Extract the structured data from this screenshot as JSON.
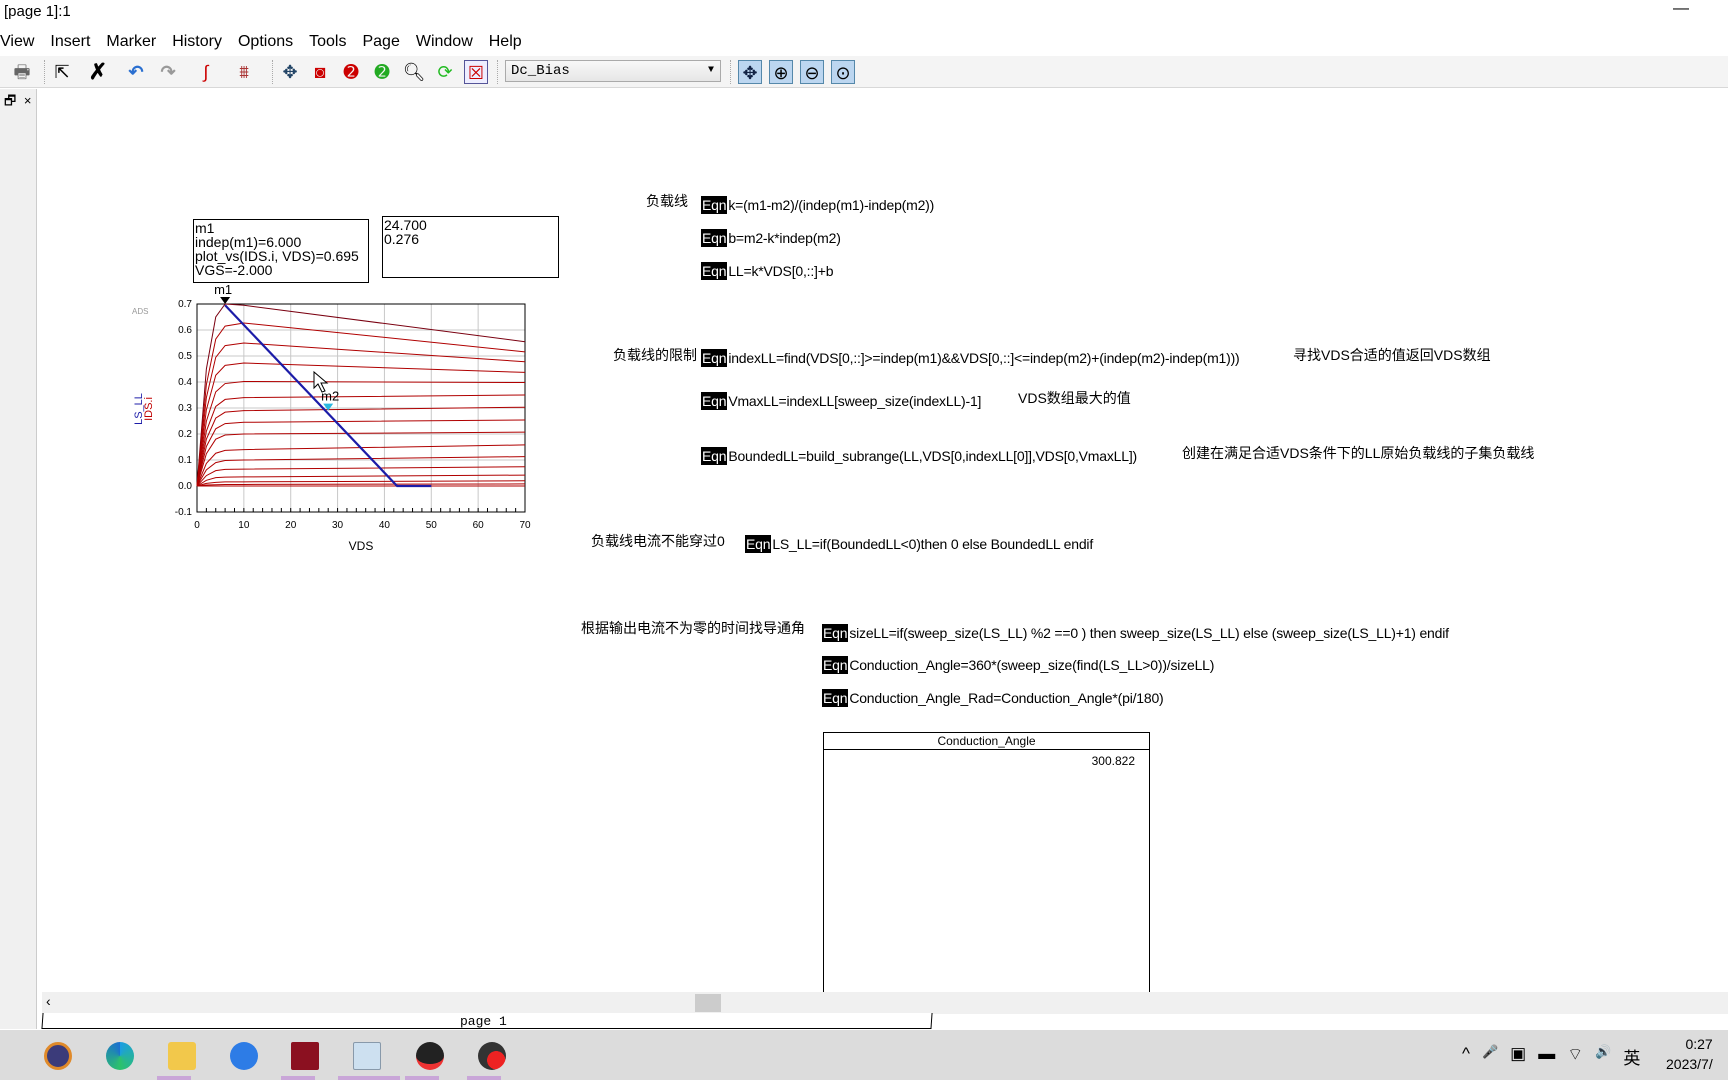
{
  "window": {
    "title": "[page 1]:1",
    "minimize": "—"
  },
  "menu": [
    "View",
    "Insert",
    "Marker",
    "History",
    "Options",
    "Tools",
    "Page",
    "Window",
    "Help"
  ],
  "toolbar": {
    "icons": [
      "save-icon",
      "print-icon",
      "select-arrow-icon",
      "delete-x-icon",
      "undo-icon",
      "redo-icon",
      "trace-icon",
      "plot-icon",
      "pan-icon",
      "zoom-box-icon",
      "zoom-in-2-icon",
      "zoom-out-2-icon",
      "zoom-icon",
      "refresh-icon",
      "clear-icon"
    ],
    "dataset": "Dc_Bias",
    "right_icons": [
      "fit-icon",
      "zoom-in-icon",
      "zoom-out-icon",
      "zoom-all-icon"
    ]
  },
  "pane": {
    "restore": "🗗",
    "close": "×"
  },
  "markers": {
    "m1_box": [
      "m1",
      "indep(m1)=6.000",
      "plot_vs(IDS.i, VDS)=0.695",
      "VGS=-2.000"
    ],
    "m2_box": [
      "24.700",
      "0.276"
    ]
  },
  "equations": [
    {
      "label": "负载线",
      "badge": "Eqn",
      "text": "k=(m1-m2)/(indep(m1)-indep(m2))"
    },
    {
      "badge": "Eqn",
      "text": "b=m2-k*indep(m2)"
    },
    {
      "badge": "Eqn",
      "text": "LL=k*VDS[0,::]+b"
    },
    {
      "label": "负载线的限制",
      "badge": "Eqn",
      "text": "indexLL=find(VDS[0,::]>=indep(m1)&&VDS[0,::]<=indep(m2)+(indep(m2)-indep(m1)))",
      "comment": "寻找VDS合适的值返回VDS数组"
    },
    {
      "badge": "Eqn",
      "text": "VmaxLL=indexLL[sweep_size(indexLL)-1]",
      "comment": "VDS数组最大的值"
    },
    {
      "badge": "Eqn",
      "text": "BoundedLL=build_subrange(LL,VDS[0,indexLL[0]],VDS[0,VmaxLL])",
      "comment": "创建在满足合适VDS条件下的LL原始负载线的子集负载线"
    },
    {
      "label": "负载线电流不能穿过0",
      "badge": "Eqn",
      "text": "LS_LL=if(BoundedLL<0)then 0 else BoundedLL endif"
    },
    {
      "label": "根据输出电流不为零的时间找导通角",
      "badge": "Eqn",
      "text": "sizeLL=if(sweep_size(LS_LL) %2 ==0 ) then sweep_size(LS_LL) else (sweep_size(LS_LL)+1) endif"
    },
    {
      "badge": "Eqn",
      "text": "Conduction_Angle=360*(sweep_size(find(LS_LL>0))/sizeLL)"
    },
    {
      "badge": "Eqn",
      "text": "Conduction_Angle_Rad=Conduction_Angle*(pi/180)"
    }
  ],
  "table": {
    "header": "Conduction_Angle",
    "value": "300.822"
  },
  "page_tab": "page 1",
  "taskbar": {
    "apps": [
      "eclipse-icon",
      "edge-icon",
      "file-explorer-icon",
      "feishu-icon",
      "ltspice-icon",
      "ads-icon",
      "qq-icon",
      "obs-icon"
    ],
    "tray": [
      "^",
      "🎤",
      "▣",
      "▬",
      "wifi",
      "🔊",
      "英"
    ],
    "time": "0:27",
    "date": "2023/7/"
  },
  "chart_data": {
    "type": "line",
    "xlabel": "VDS",
    "ylabels": [
      {
        "text": "LS_LL",
        "color": "#1c1ca8"
      },
      {
        "text": "IDS.i",
        "color": "#c00000"
      }
    ],
    "watermark": "ADS",
    "xlim": [
      0,
      70
    ],
    "ylim": [
      -0.1,
      0.7
    ],
    "xticks": [
      "0",
      "10",
      "20",
      "30",
      "40",
      "50",
      "60",
      "70"
    ],
    "yticks": [
      "-0.1",
      "0.0",
      "0.1",
      "0.2",
      "0.3",
      "0.4",
      "0.5",
      "0.6",
      "0.7"
    ],
    "grid": true,
    "ids_x": [
      0,
      2,
      4,
      6,
      10,
      70
    ],
    "ids_curves": [
      [
        0,
        0.45,
        0.65,
        0.7,
        0.695,
        0.555
      ],
      [
        0,
        0.39,
        0.565,
        0.615,
        0.627,
        0.516
      ],
      [
        0,
        0.34,
        0.495,
        0.54,
        0.55,
        0.478
      ],
      [
        0,
        0.293,
        0.426,
        0.464,
        0.473,
        0.437
      ],
      [
        0,
        0.249,
        0.362,
        0.394,
        0.402,
        0.398
      ],
      [
        0,
        0.211,
        0.306,
        0.333,
        0.34,
        0.35
      ],
      [
        0,
        0.18,
        0.261,
        0.284,
        0.29,
        0.303
      ],
      [
        0,
        0.152,
        0.22,
        0.24,
        0.245,
        0.254
      ],
      [
        0,
        0.124,
        0.18,
        0.196,
        0.2,
        0.207
      ],
      [
        0,
        0.087,
        0.126,
        0.137,
        0.14,
        0.158
      ],
      [
        0,
        0.062,
        0.09,
        0.098,
        0.1,
        0.113
      ],
      [
        0,
        0.04,
        0.059,
        0.064,
        0.065,
        0.074
      ],
      [
        0,
        0.022,
        0.032,
        0.034,
        0.035,
        0.042
      ],
      [
        0,
        0.01,
        0.014,
        0.016,
        0.016,
        0.02
      ],
      [
        0,
        0.004,
        0.005,
        0.006,
        0.006,
        0.008
      ],
      [
        0,
        0,
        0,
        0,
        0,
        0
      ]
    ],
    "ids_color": "#b00000",
    "load_line": {
      "name": "LS_LL",
      "x": [
        6,
        42.7,
        50
      ],
      "y": [
        0.695,
        0,
        0
      ],
      "color": "#1c1ca8"
    },
    "markers": [
      {
        "name": "m1",
        "x": 6,
        "y": 0.7,
        "color": "#000"
      },
      {
        "name": "m2",
        "x": 28,
        "y": 0.29,
        "color": "#2ab8e0"
      }
    ]
  }
}
